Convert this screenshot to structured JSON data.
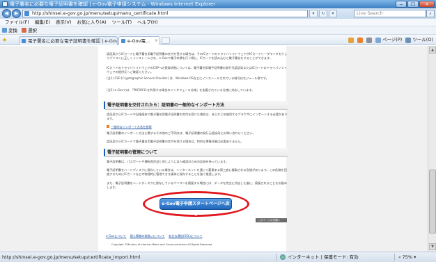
{
  "window": {
    "title": "電子署名に必要な電子証明書を確認 | e-Gov電子申請システム - Windows Internet Explorer",
    "controls": {
      "minimize": "‒",
      "maximize": "□",
      "close": "×"
    }
  },
  "address_bar": {
    "url": "http://shinsei.e-gov.go.jp/menu/setup/manu_certificate.html",
    "search_placeholder": "Live Search",
    "back_icon": "back-arrow-icon",
    "forward_icon": "forward-arrow-icon"
  },
  "menu": [
    "ファイル(F)",
    "編集(E)",
    "表示(V)",
    "お気に入り(A)",
    "ツール(T)",
    "ヘルプ(H)"
  ],
  "favorites_bar": {
    "convert_label": "変換",
    "select_label": "選択"
  },
  "tabs": [
    {
      "label": "電子署名に必要な電子証明書を確認 | e-Gov電...",
      "active": false
    },
    {
      "label": "e-Gov電...",
      "active": true
    }
  ],
  "command_bar": {
    "page_label": "ページ(P)",
    "tools_label": "ツール(O)"
  },
  "content": {
    "para1": "認証局からICカードに電子署名用電子証明書の交付を受ける場合は、そのICカードのドライバソフトウェアがICカードリーダライタを介してパソコンに正しくインストールされ、e-Govで電子申請を行う際に、ICカードを読み込むと電子署名をすることができます。",
    "para2": "ICカードのドライバソフトウェアのCSPへの登録状態については、電子署名用電子証明書の発行元認証局またはICカードのドライバソフトウェアの提供元へご確認ください。",
    "para3": "(注1) CSP (Cryptographic Service Provider) は、Windows OSなどにインストールされている暗号化モジュール群です。",
    "para4": "(注2) e-Govでは、「PKCS#11を利用する場合のインタフェース仕様」を定義されている仕様に対応しています。",
    "section1_heading": "電子証明書を交付されたら：証明書の一般的なインポート方法",
    "para5": "認証局からICカードや記憶媒体で電子署名用電子証明書の交付を受けた場合は、あらかじめ使用するブラウザにインポートする必要があります。",
    "link1": "一般的なインポート方法を参照",
    "para6": "電子証明書のインポート方法に関するその他のご不明点は、電子証明書の発行元認証局にお問い合わせください。",
    "para7": "認証局からICカードで電子署名用電子証明書の交付を受ける場合は、特別な準備作業は必要ありません。",
    "section2_heading": "電子証明書の管理について",
    "para8": "電子証明書は、パスポートや運転免許証と同じように本人確認のための記録を持っています。",
    "para9": "電子証明書をハードディスクに保存している場合は、インターネットを通じて悪意ある第三者に複製される危険があります。この危険を回避するためにICカードなどの物理的に管理できる媒体に保存することを強く推奨します。",
    "para10": "また、電子証明書をハードディスクに保存しているパソコンを廃棄する場合には、データを完全に消去した後に、廃棄されることをお勧めします。",
    "start_button": "e-Gov電子申請スタートページへ戻る",
    "page_top": "このページの先頭へ",
    "footer_links": [
      "e-Govについて",
      "個人情報の取扱いについて",
      "安全な通信(SSL)について"
    ],
    "copyright": "Copyright ©Ministry of Internal Affairs and Communications All Rights Reserved."
  },
  "status_bar": {
    "url": "http://shinsei.e-gov.go.jp/menu/setup/certificate_import.html",
    "zone": "インターネット | 保護モード: 有効",
    "zoom": "75%"
  },
  "colors": {
    "highlight_ring": "#e0181e",
    "start_button": "#1f66bb",
    "section_bar": "#1a5fb0"
  }
}
